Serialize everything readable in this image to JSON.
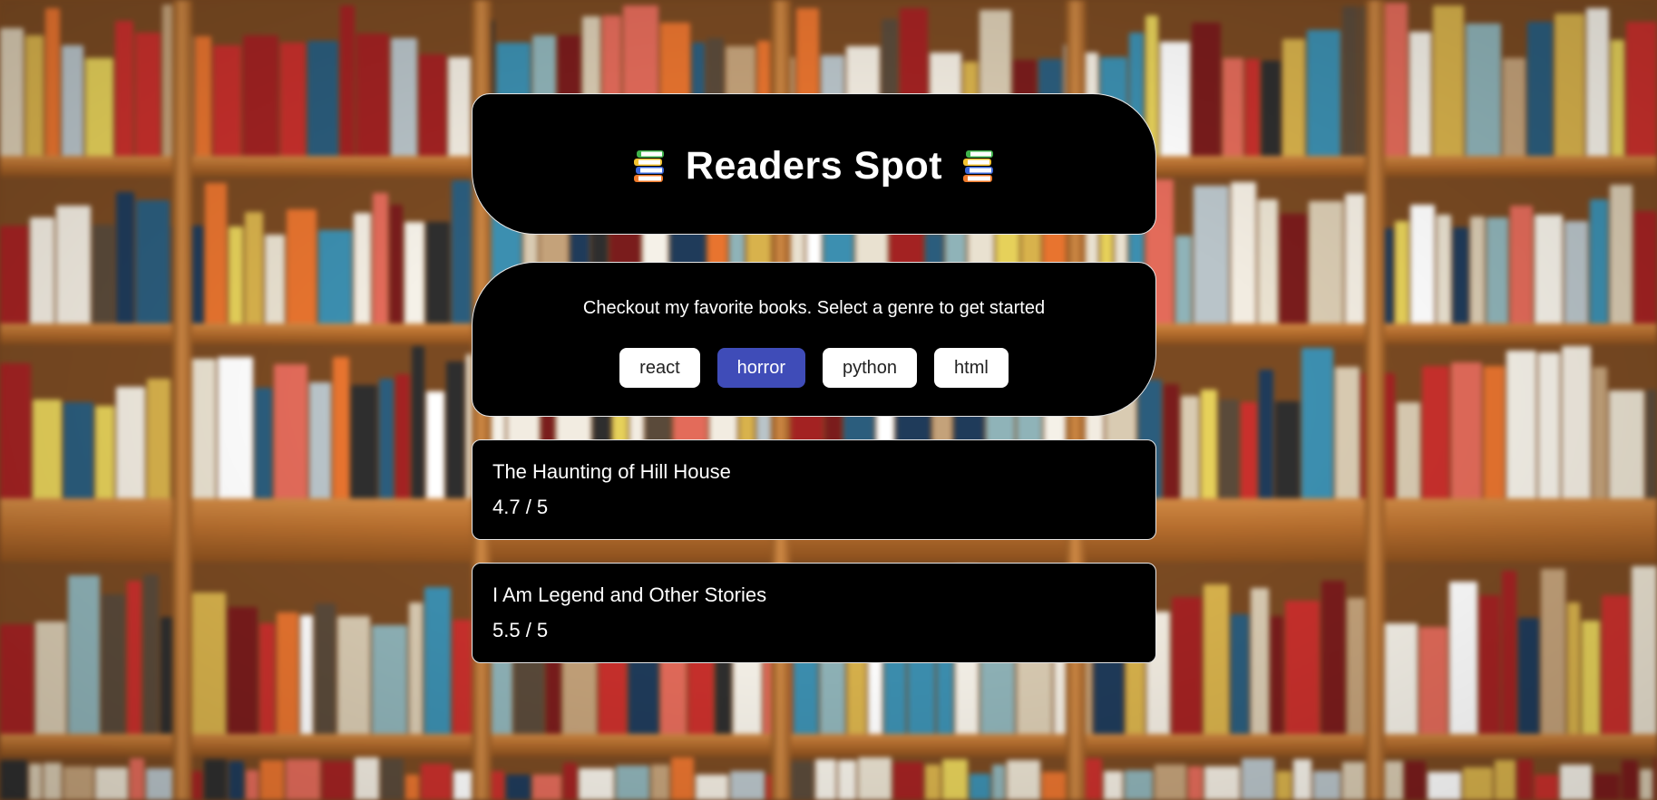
{
  "header": {
    "title": "Readers Spot",
    "left_icon": "books-icon",
    "right_icon": "books-icon"
  },
  "intro": {
    "text": "Checkout my favorite books. Select a genre to get started"
  },
  "genres": [
    {
      "label": "react",
      "selected": false
    },
    {
      "label": "horror",
      "selected": true
    },
    {
      "label": "python",
      "selected": false
    },
    {
      "label": "html",
      "selected": false
    }
  ],
  "books": [
    {
      "name": "The Haunting of Hill House",
      "rating": "4.7 / 5"
    },
    {
      "name": "I Am Legend and Other Stories",
      "rating": "5.5 / 5"
    }
  ],
  "colors": {
    "card_background": "#000000",
    "card_border": "#e6e6e6",
    "selected_genre": "#3f4cb8",
    "genre_button": "#ffffff"
  }
}
